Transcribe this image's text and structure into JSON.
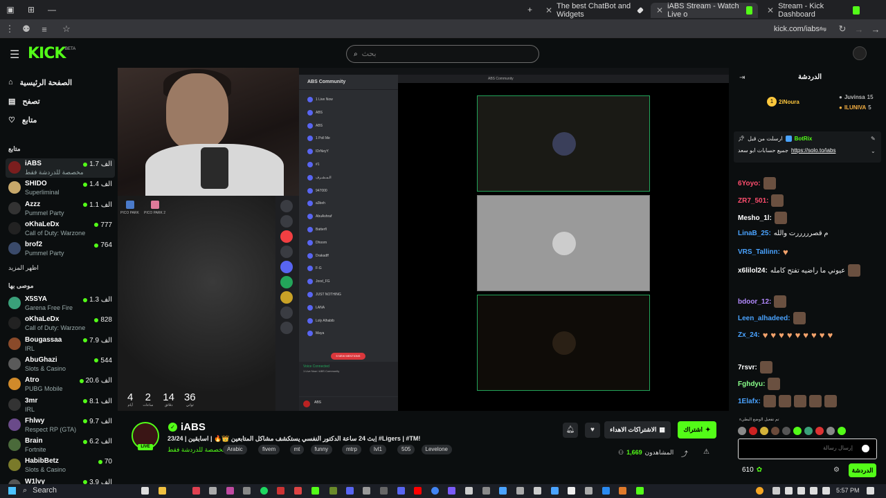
{
  "browser": {
    "tabs": [
      {
        "title": "The best ChatBot and Widgets",
        "fav_color": "#aaaaaa",
        "active": false
      },
      {
        "title": "iABS Stream - Watch Live o",
        "fav_color": "#53fc18",
        "active": true
      },
      {
        "title": "Stream - Kick Dashboard",
        "fav_color": "#53fc18",
        "active": false
      }
    ],
    "url": "kick.com/iabs"
  },
  "header": {
    "logo": "KICK",
    "beta": "BETA",
    "search_placeholder": "بحث"
  },
  "sidebar": {
    "nav": [
      {
        "label": "الصفحة الرئيسية",
        "icon": "home-icon"
      },
      {
        "label": "تصفح",
        "icon": "browse-icon"
      },
      {
        "label": "متابع",
        "icon": "heart-icon"
      }
    ],
    "following_title": "متابع",
    "following": [
      {
        "name": "iABS",
        "category": "مخصصة للدردشة فقط",
        "viewers": "1.7 الف",
        "color": "#7a1e1e"
      },
      {
        "name": "SHIDO",
        "category": "Superliminal",
        "viewers": "1.4 الف",
        "color": "#c7a86a"
      },
      {
        "name": "Azzz",
        "category": "Pummel Party",
        "viewers": "1.1 الف",
        "color": "#333333"
      },
      {
        "name": "oKhaLeDx",
        "category": "Call of Duty: Warzone",
        "viewers": "777",
        "color": "#222222"
      },
      {
        "name": "brof2",
        "category": "Pummel Party",
        "viewers": "764",
        "color": "#3a4a6a"
      }
    ],
    "show_more": "اظهر المزيد",
    "recommended_title": "موصى بها",
    "recommended": [
      {
        "name": "X5SYA",
        "category": "Garena Free Fire",
        "viewers": "1.3 الف",
        "color": "#3aa07a"
      },
      {
        "name": "oKhaLeDx",
        "category": "Call of Duty: Warzone",
        "viewers": "828",
        "color": "#222222"
      },
      {
        "name": "Bougassaa",
        "category": "IRL",
        "viewers": "7.9 الف",
        "color": "#8a4a2a"
      },
      {
        "name": "AbuGhazi",
        "category": "Slots & Casino",
        "viewers": "544",
        "color": "#5a5a5a"
      },
      {
        "name": "Atro",
        "category": "PUBG Mobile",
        "viewers": "20.6 الف",
        "color": "#d08a2a"
      },
      {
        "name": "3mr",
        "category": "IRL",
        "viewers": "8.1 الف",
        "color": "#333333"
      },
      {
        "name": "Fhlwy",
        "category": "Respect RP (GTA)",
        "viewers": "9.7 الف",
        "color": "#6a4a8a"
      },
      {
        "name": "Brain",
        "category": "Fortnite",
        "viewers": "6.2 الف",
        "color": "#4a6a3a"
      },
      {
        "name": "HabibBetz",
        "category": "Slots & Casino",
        "viewers": "70",
        "color": "#7a7a2a"
      },
      {
        "name": "W1lvy",
        "category": "",
        "viewers": "3.9 الف",
        "color": "#555555"
      }
    ]
  },
  "video": {
    "pico": [
      "PICO PARK",
      "PICO PARK 2"
    ],
    "timer": [
      {
        "num": "4",
        "label": "أيام"
      },
      {
        "num": "2",
        "label": "ساعات"
      },
      {
        "num": "14",
        "label": "دقائق"
      },
      {
        "num": "36",
        "label": "ثواني"
      }
    ],
    "discord": {
      "server": "ABS Community",
      "channels": [
        "1 Live Now",
        "ABS",
        "ABS",
        "1 Poll Me",
        "IDrNeyY",
        "#1",
        "الـمـشـرف",
        "947000",
        "a3beh",
        "AbuAshraf",
        "Batterfl",
        "Dhoom",
        "Drakadff",
        "F-G",
        "Jood_FG",
        "JUST NOTHING",
        "LANA",
        "Loly Alhabib",
        "Maya"
      ],
      "new_mentions": "5 NEW MENTIONS",
      "voice": "Voice Connected",
      "voice_sub": "1 Live Now / ABS Community",
      "user": "ABS",
      "window_title": "ABS Community"
    }
  },
  "stream": {
    "channel_name": "iABS",
    "live": "LIVE",
    "title": "بث 24 ساعة الدكتور النفسي يستكشف مشاكل المتابعين 👑🔥 | اسابقين | 23/24| #Ligers | #TM!",
    "category": "مخصصة للدردشة فقط",
    "tags": [
      "Arabic",
      "fivem",
      "mt",
      "funny",
      "mtrp",
      "lvl1",
      "505",
      "Levelone"
    ],
    "gift_label": "الاشتراكات الاهداء",
    "subscribe_label": "اشتراك",
    "viewers_label": "المشاهدون",
    "viewers_count": "1,669"
  },
  "chat": {
    "title": "الدردشة",
    "gifters": [
      {
        "name": "2iNoura",
        "count": "",
        "color": "#ffc83d"
      },
      {
        "name": "Juvinsa",
        "count": "15",
        "color": "#bbbbbb"
      },
      {
        "name": "ILUNIVA",
        "count": "5",
        "color": "#f5b042"
      }
    ],
    "pinned_by": "ارسلت من قبل",
    "pinned_user": "BotRix",
    "pinned_text": "جميع حسابات ابو سعد",
    "pinned_link": "https://solo.to/iabs",
    "messages": [
      {
        "user": "6Yoyo:",
        "color": "#ff4e6e",
        "text": "",
        "emotes": 1
      },
      {
        "user": "ZR7_501:",
        "color": "#ff4e6e",
        "text": "",
        "emotes": 1
      },
      {
        "user": "Mesho_1l:",
        "color": "#ffffff",
        "text": "",
        "emotes": 1
      },
      {
        "user": "LinaB_25:",
        "color": "#4aa3ff",
        "text": "م قصرررررت والله",
        "emotes": 0
      },
      {
        "user": "VRS_Tallinn:",
        "color": "#4aa3ff",
        "text": "",
        "emotes": 0,
        "hearts": 1
      },
      {
        "user": "x6lilol24:",
        "color": "#ffffff",
        "text": "عيوني ما راضيه تفتح كامله",
        "emotes": 1
      },
      {
        "user": "bdoor_12:",
        "color": "#b38aff",
        "text": "",
        "emotes": 1
      },
      {
        "user": "Leen_alhadeed:",
        "color": "#4aa3ff",
        "text": "",
        "emotes": 1
      },
      {
        "user": "Zx_24:",
        "color": "#4aa3ff",
        "text": "",
        "emotes": 0,
        "hearts": 9
      },
      {
        "user": "7rsvr:",
        "color": "#ffffff",
        "text": "",
        "emotes": 1
      },
      {
        "user": "Fghdyu:",
        "color": "#8aff8a",
        "text": "",
        "emotes": 1
      },
      {
        "user": "1Elafx:",
        "color": "#4aa3ff",
        "text": "",
        "emotes": 5
      }
    ],
    "mode_note": "تم تفعيل الوضع البطيء",
    "input_placeholder": "إرسال رسالة",
    "points": "610",
    "chat_button": "الدردشة"
  },
  "taskbar": {
    "search": "Search",
    "time": "5:57 PM"
  }
}
